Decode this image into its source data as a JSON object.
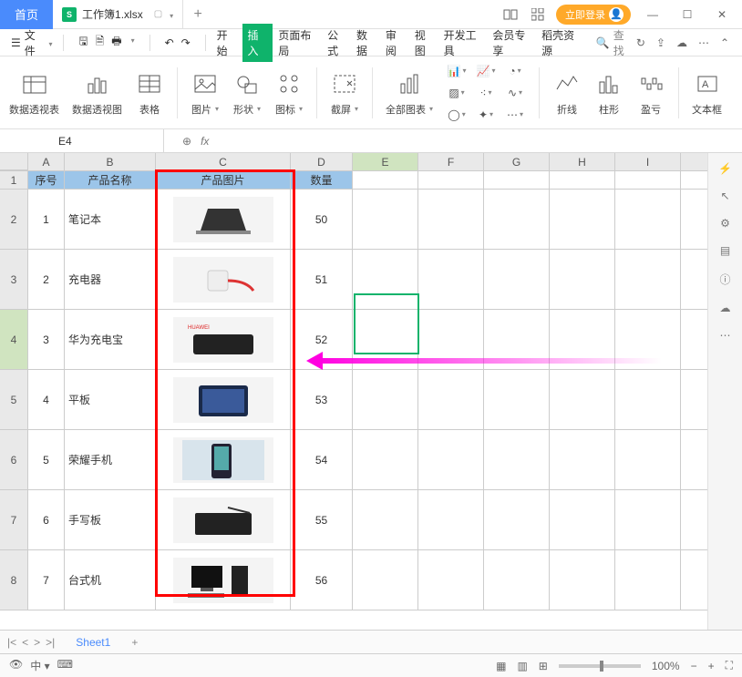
{
  "titlebar": {
    "home": "首页",
    "file_name": "工作簿1.xlsx",
    "login": "立即登录"
  },
  "menu": {
    "file": "文件",
    "items": [
      "开始",
      "插入",
      "页面布局",
      "公式",
      "数据",
      "审阅",
      "视图",
      "开发工具",
      "会员专享",
      "稻壳资源"
    ],
    "active_index": 1,
    "search": "查找"
  },
  "ribbon": {
    "pivot_table": "数据透视表",
    "pivot_chart": "数据透视图",
    "table": "表格",
    "picture": "图片",
    "shape": "形状",
    "icon": "图标",
    "screenshot": "截屏",
    "all_charts": "全部图表",
    "line": "折线",
    "column": "柱形",
    "winloss": "盈亏",
    "textbox": "文本框"
  },
  "formula": {
    "cell_ref": "E4",
    "fx": "fx"
  },
  "columns": [
    "A",
    "B",
    "C",
    "D",
    "E",
    "F",
    "G",
    "H",
    "I"
  ],
  "header_row": {
    "a": "序号",
    "b": "产品名称",
    "c": "产品图片",
    "d": "数量"
  },
  "rows": [
    {
      "n": "1",
      "name": "笔记本",
      "qty": "50"
    },
    {
      "n": "2",
      "name": "充电器",
      "qty": "51"
    },
    {
      "n": "3",
      "name": "华为充电宝",
      "qty": "52"
    },
    {
      "n": "4",
      "name": "平板",
      "qty": "53"
    },
    {
      "n": "5",
      "name": "荣耀手机",
      "qty": "54"
    },
    {
      "n": "6",
      "name": "手写板",
      "qty": "55"
    },
    {
      "n": "7",
      "name": "台式机",
      "qty": "56"
    }
  ],
  "sheet_tab": "Sheet1",
  "status": {
    "zoom": "100%"
  }
}
